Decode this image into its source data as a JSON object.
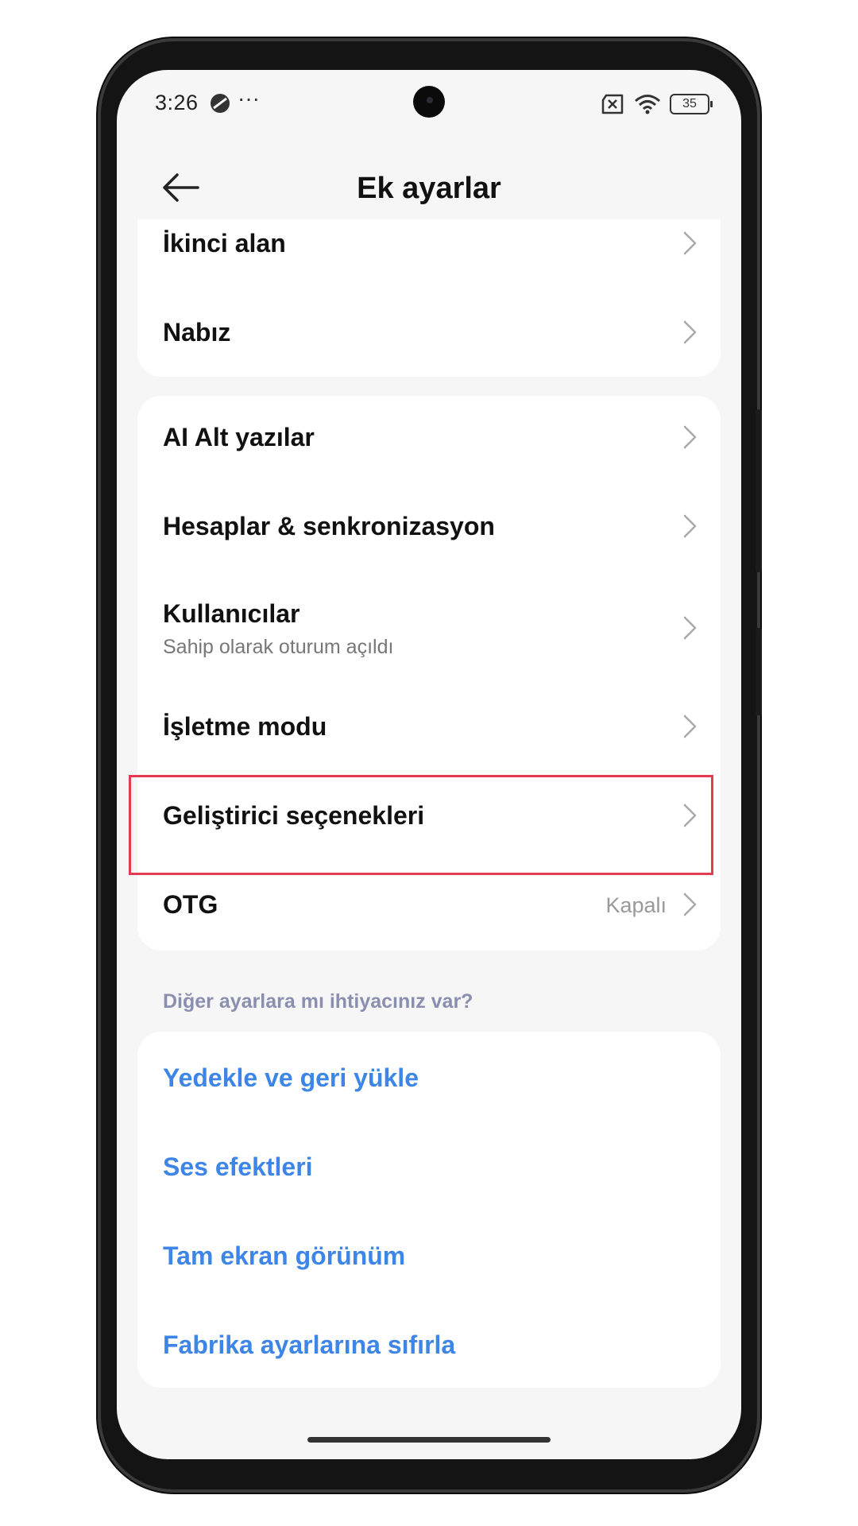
{
  "status_bar": {
    "time": "3:26",
    "dots": "···",
    "battery": "35"
  },
  "header": {
    "title": "Ek ayarlar"
  },
  "group1": {
    "items": [
      {
        "label": "İkinci alan"
      },
      {
        "label": "Nabız"
      }
    ]
  },
  "group2": {
    "items": [
      {
        "label": "AI Alt yazılar"
      },
      {
        "label": "Hesaplar & senkronizasyon"
      },
      {
        "label": "Kullanıcılar",
        "subtitle": "Sahip olarak oturum açıldı"
      },
      {
        "label": "İşletme modu"
      },
      {
        "label": "Geliştirici seçenekleri"
      },
      {
        "label": "OTG",
        "value": "Kapalı"
      }
    ]
  },
  "more_settings": {
    "header": "Diğer ayarlara mı ihtiyacınız var?",
    "links": [
      {
        "label": "Yedekle ve geri yükle"
      },
      {
        "label": "Ses efektleri"
      },
      {
        "label": "Tam ekran görünüm"
      },
      {
        "label": "Fabrika ayarlarına sıfırla"
      }
    ]
  },
  "colors": {
    "link": "#3d85e6",
    "highlight": "#e33b50",
    "section_header": "#8a8fb0",
    "background": "#f6f6f6"
  },
  "icons": {
    "back": "back-arrow-icon",
    "chevron": "chevron-right-icon",
    "dnd": "do-not-disturb-icon",
    "sim": "no-sim-icon",
    "wifi": "wifi-icon",
    "battery": "battery-icon"
  }
}
